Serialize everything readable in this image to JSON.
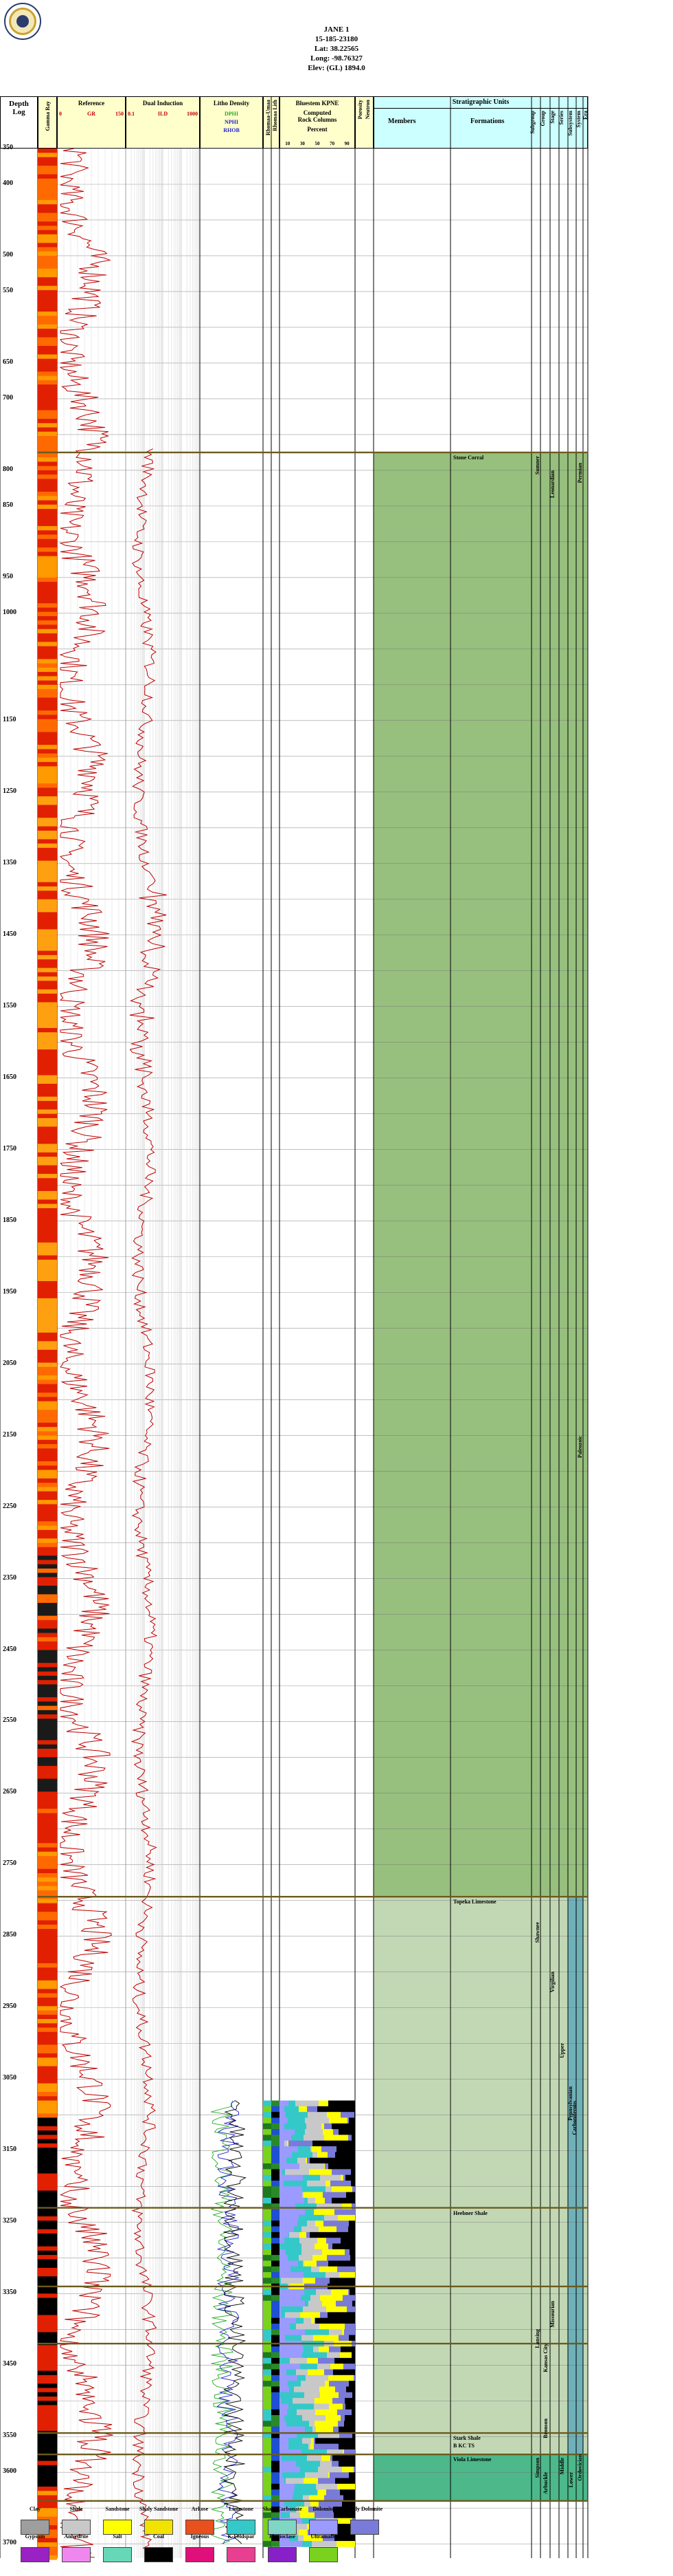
{
  "header": {
    "well_name": "JANE 1",
    "api": "15-185-23180",
    "lat": "Lat: 38.22565",
    "long": "Long: -98.76327",
    "elev": "Elev: (GL) 1894.0"
  },
  "tracks": {
    "depth": "Depth",
    "log": "Log",
    "gamma_ray": "Gamma Ray",
    "reference": "Reference",
    "gr_label": "GR",
    "gr_min": "0",
    "gr_max": "150",
    "dual_induction": "Dual Induction",
    "ild_label": "ILD",
    "ild_min": "0.1",
    "ild_max": "1000",
    "litho_density": "Litho Density",
    "dpor_min": "-0.1",
    "dpor_label": "DPHI",
    "nphi_label": "NPHI",
    "rhob_label": "RHOB",
    "shale_hint": "Shale Factor",
    "rhomaa_umaa": "Rhomaa-Umaa",
    "rhomaa_lithology": "Rhomaa Lith",
    "bluestem": "Bluestem KPNE",
    "computed": "Computed",
    "rock": "Rock Columns",
    "percent": "Percent",
    "pct_ticks": [
      "10",
      "30",
      "50",
      "70",
      "90"
    ],
    "porosity": "Porosity",
    "neutron": "Neutron",
    "strat": "Stratigraphic Units",
    "members": "Members",
    "formations": "Formations",
    "col_subgroup": "Subgroup",
    "col_group": "Group",
    "col_stage": "Stage",
    "col_series": "Series",
    "col_subsystem": "Subsystem",
    "col_system": "System",
    "col_era": "Era"
  },
  "depth_ticks": [
    "350",
    "400",
    "500",
    "550",
    "650",
    "700",
    "800",
    "850",
    "950",
    "1000",
    "1150",
    "1250",
    "1350",
    "1450",
    "1550",
    "1650",
    "1750",
    "1850",
    "1950",
    "2050",
    "2150",
    "2250",
    "2350",
    "2450",
    "2550",
    "2650",
    "2750",
    "2850",
    "2950",
    "3050",
    "3150",
    "3250",
    "3350",
    "3450",
    "3550",
    "3600",
    "3700"
  ],
  "formations": [
    {
      "name": "Stone Corral"
    },
    {
      "name": "Topeka Limestone"
    },
    {
      "name": "Heebner Shale"
    },
    {
      "name": "Stark Shale"
    },
    {
      "name": "B KC TS"
    },
    {
      "name": "Viola Limestone"
    }
  ],
  "strat_units": {
    "permian": "Permian",
    "sumner": "Sumner",
    "leonardian": "Leonardian",
    "paleozoic": "Paleozoic",
    "shawnee": "Shawnee",
    "virgilian": "Virgilian",
    "carboniferous": "Carboniferous",
    "pennsylvanian": "Pennsylvanian",
    "upper": "Upper",
    "lansing": "Lansing",
    "missourian": "Missourian",
    "kansas_city": "Kansas City",
    "bronson": "Bronson",
    "ordovician": "Ordovician",
    "middle": "Middle",
    "lower": "Lower",
    "simpson": "Simpson",
    "arbuckle": "Arbuckle"
  },
  "legend": [
    {
      "label": "Clay",
      "color": "#9e9e9e"
    },
    {
      "label": "Shale",
      "color": "#c8c8c8"
    },
    {
      "label": "Sandstone",
      "color": "#ffff00"
    },
    {
      "label": "Shaly Sandstone",
      "color": "#f2e200"
    },
    {
      "label": "Arkose",
      "color": "#e8501e"
    },
    {
      "label": "Limestone",
      "color": "#35c8c8"
    },
    {
      "label": "Shaly Carbonate",
      "color": "#7fd6c5"
    },
    {
      "label": "Dolomite",
      "color": "#9a9aff"
    },
    {
      "label": "Shaly Dolomite",
      "color": "#7a7ad8"
    },
    {
      "label": "Gypsum",
      "color": "#9a21c4"
    },
    {
      "label": "Anhydrite",
      "color": "#ee88ee"
    },
    {
      "label": "Salt",
      "color": "#66d8b8"
    },
    {
      "label": "Coal",
      "color": "#000000"
    },
    {
      "label": "Igneous",
      "color": "#e0107a"
    },
    {
      "label": "K-Feldspar",
      "color": "#e84090"
    },
    {
      "label": "Plagioclase",
      "color": "#8820c8"
    },
    {
      "label": "Ultramafic",
      "color": "#7ad21e"
    }
  ],
  "colors": {
    "header_fill": "#ffffcc",
    "strat_header": "#ccffff",
    "leonardian_fill": "#97bf7e",
    "virgilian_fill": "#c2d8b5",
    "ordovician_fill": "#4db88a",
    "formation_line": "#6b5b1e",
    "gr_curve": "#c00000",
    "ild_curve": "#c00000"
  }
}
